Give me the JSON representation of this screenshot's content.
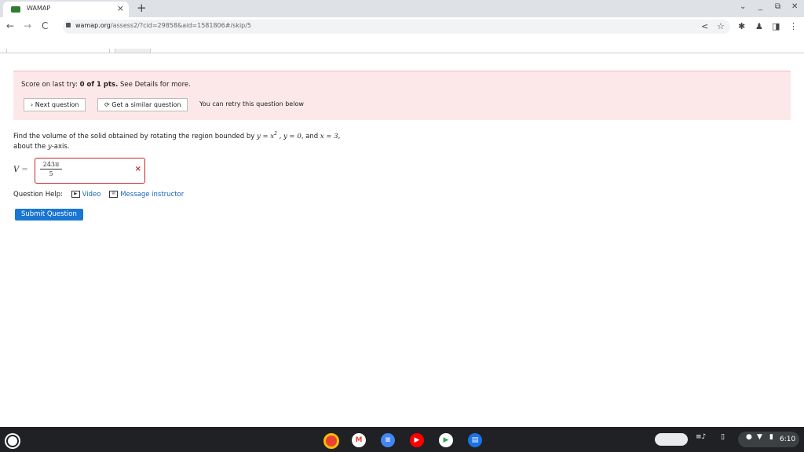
{
  "browser": {
    "tab_title": "WAMAP",
    "tab_close": "×",
    "new_tab": "+",
    "url_host": "wamap.org",
    "url_path": "/assess2/?cid=29858&aid=1581806#/skip/5",
    "window_controls": [
      "⌄",
      "_",
      "⧉",
      "✕"
    ],
    "nav": {
      "back": "←",
      "forward": "→",
      "reload": "C"
    },
    "toolbar_icons": {
      "share": "<",
      "star": "☆",
      "extensions": "✱",
      "profile": "♟",
      "sidepanel": "◨",
      "menu": "⋮"
    }
  },
  "score": {
    "prefix": "Score on last try: ",
    "value": "0 of 1 pts.",
    "suffix": " See Details for more.",
    "next_button": "› Next question",
    "similar_button": "⟳ Get a similar question",
    "retry_text": "You can retry this question below"
  },
  "question": {
    "line1_a": "Find the volume of the solid obtained by rotating the region bounded by ",
    "eq1": "y = x",
    "exp": "2",
    "sep": " , ",
    "eq2": "y = 0",
    "and": ", and ",
    "eq3": "x = 3",
    "end": ",",
    "line2_a": "about the ",
    "axis": "y",
    "line2_b": "-axis."
  },
  "answer": {
    "label": "V",
    "equals": " =",
    "numerator": "243π",
    "denominator": "5",
    "status_icon": "×"
  },
  "help": {
    "label": "Question Help:",
    "video": "Video",
    "message": "Message instructor"
  },
  "submit_label": "Submit Question",
  "taskbar": {
    "time": "6:10",
    "app_colors": {
      "chrome": "#ea4335",
      "gmail": "#ffffff",
      "docs": "#4285f4",
      "youtube": "#ff0000",
      "play": "#34a853",
      "messages": "#1a73e8"
    }
  }
}
